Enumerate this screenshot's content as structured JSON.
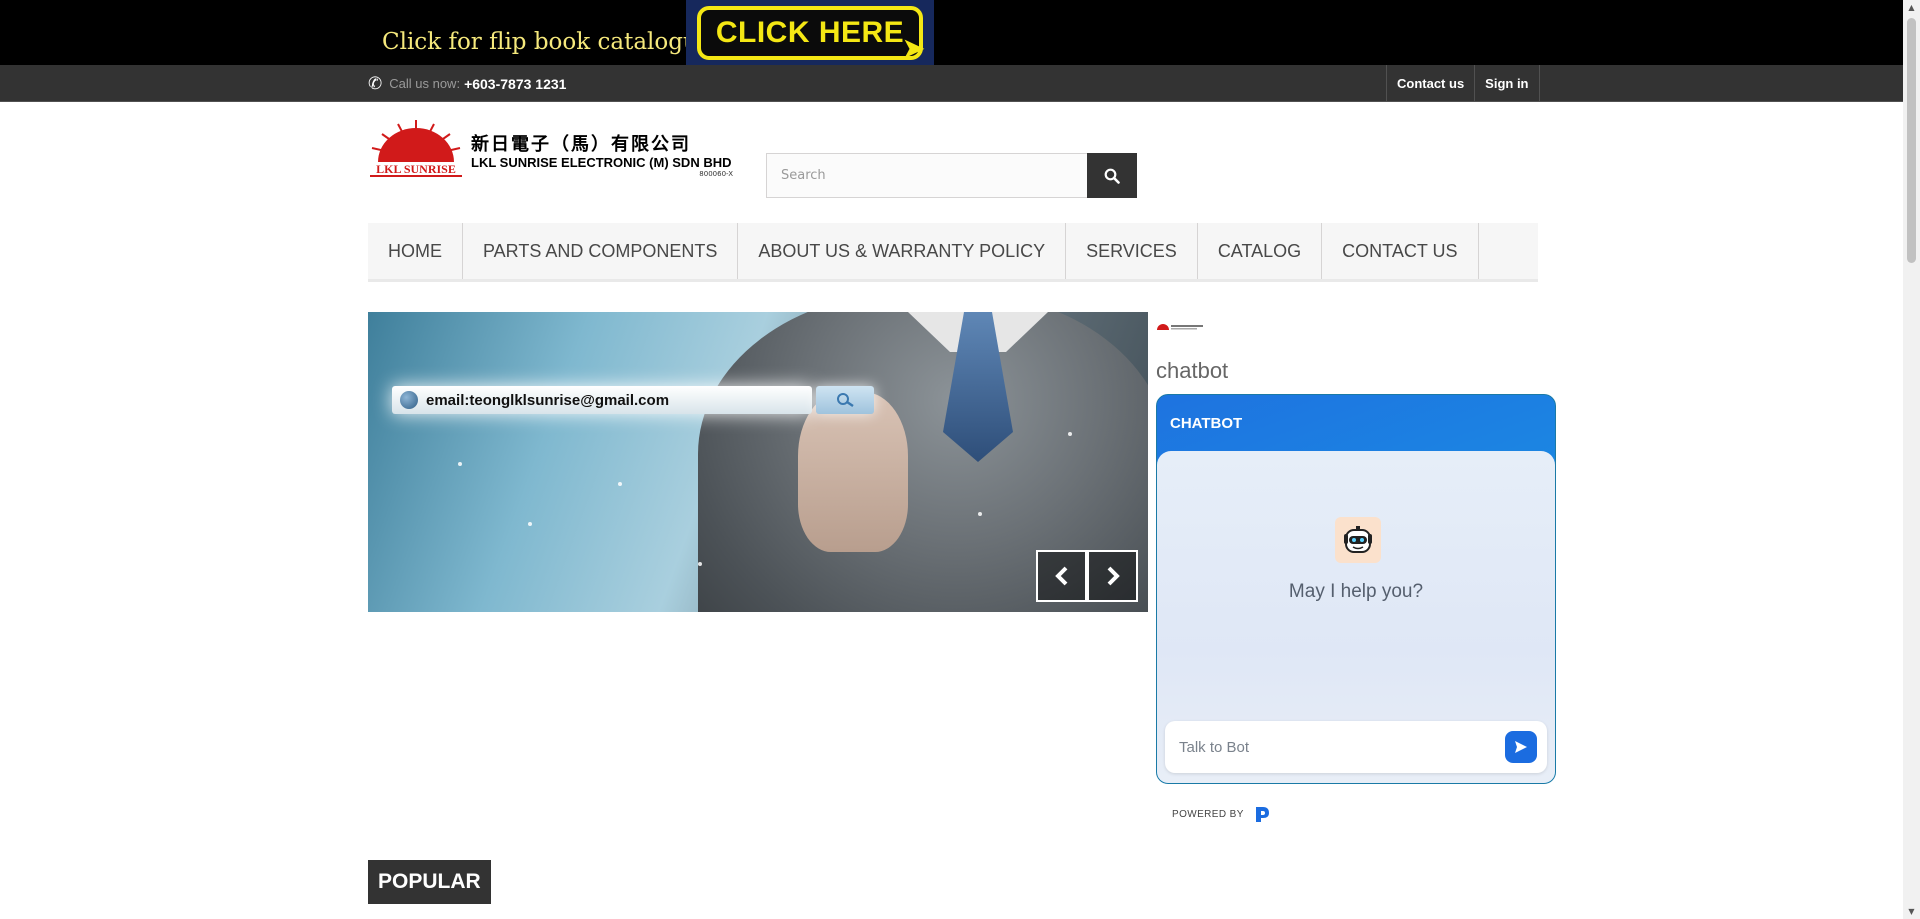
{
  "banner": {
    "text": "Click for flip book catalogue",
    "cta": "CLICK HERE"
  },
  "header_nav": {
    "call_label": "Call us now:",
    "phone": "+603-7873 1231",
    "links": [
      "Contact us",
      "Sign in"
    ]
  },
  "logo": {
    "brand_mark": "LKL SUNRISE",
    "chinese_name": "新日電子（馬）有限公司",
    "english_name": "LKL SUNRISE ELECTRONIC (M) SDN BHD",
    "reg_no": "800060-X"
  },
  "search": {
    "placeholder": "Search"
  },
  "menu": {
    "items": [
      "HOME",
      "PARTS AND COMPONENTS",
      "ABOUT US & WARRANTY POLICY",
      "SERVICES",
      "CATALOG",
      "CONTACT US"
    ]
  },
  "slider": {
    "email_text": "email:teonglklsunrise@gmail.com"
  },
  "sidebar": {
    "heading": "chatbot"
  },
  "chat": {
    "title": "CHATBOT",
    "message": "May I help you?",
    "input_placeholder": "Talk to Bot",
    "powered_by": "POWERED BY"
  },
  "section": {
    "popular": "POPULAR"
  },
  "colors": {
    "banner_text": "#f6e97c",
    "cta_yellow": "#f4e714",
    "nav_dark": "#333333",
    "chat_blue": "#1e73e0",
    "logo_red": "#d11a1a"
  }
}
